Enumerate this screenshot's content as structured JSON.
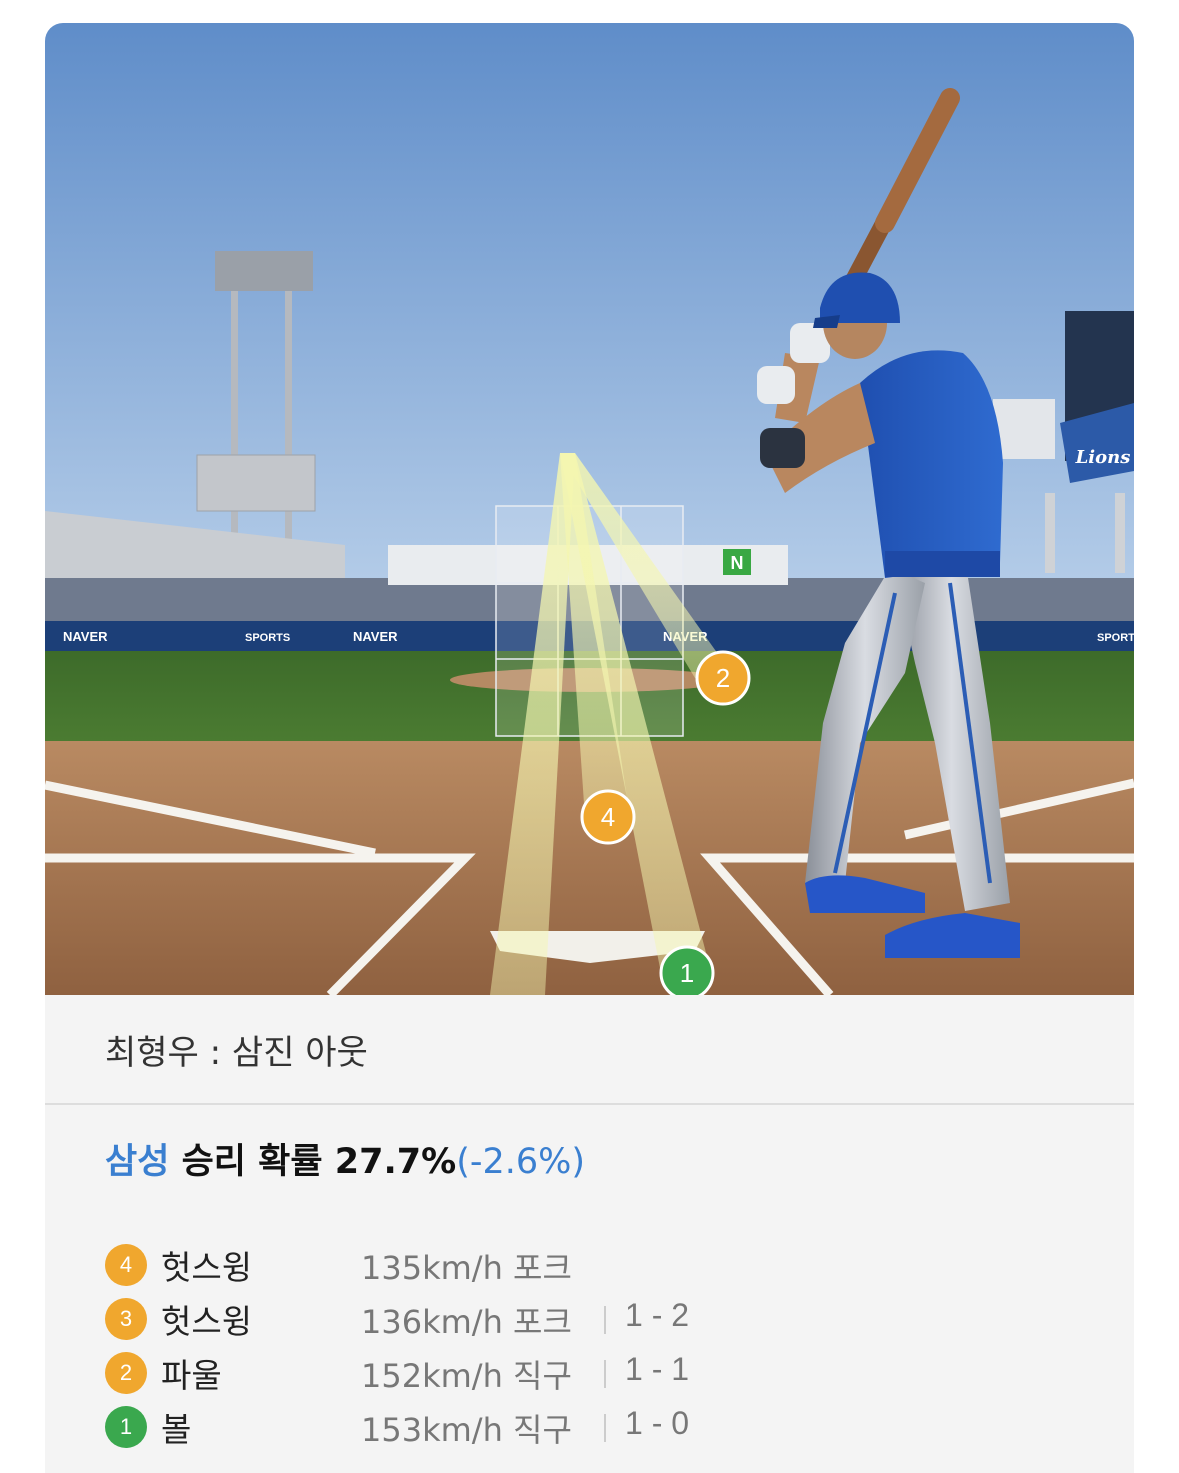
{
  "scene": {
    "board_logo": "Lions",
    "ad_naver": "NAVER",
    "ad_sports": "SPORTS",
    "ad_n": "N",
    "markers": [
      {
        "label": "1",
        "color": "#3aa84e"
      },
      {
        "label": "2",
        "color": "#f0a72e"
      },
      {
        "label": "4",
        "color": "#f0a72e"
      }
    ]
  },
  "caption": "최형우 : 삼진 아웃",
  "win_prob": {
    "team": "삼성",
    "label": "승리 확률",
    "value": "27.7%",
    "delta": "(-2.6%)"
  },
  "pitches": [
    {
      "num": "4",
      "color": "orange",
      "result": "헛스윙",
      "speed": "135km/h",
      "type": "포크",
      "count": ""
    },
    {
      "num": "3",
      "color": "orange",
      "result": "헛스윙",
      "speed": "136km/h",
      "type": "포크",
      "count": "1 - 2"
    },
    {
      "num": "2",
      "color": "orange",
      "result": "파울",
      "speed": "152km/h",
      "type": "직구",
      "count": "1 - 1"
    },
    {
      "num": "1",
      "color": "green",
      "result": "볼",
      "speed": "153km/h",
      "type": "직구",
      "count": "1 - 0"
    }
  ]
}
